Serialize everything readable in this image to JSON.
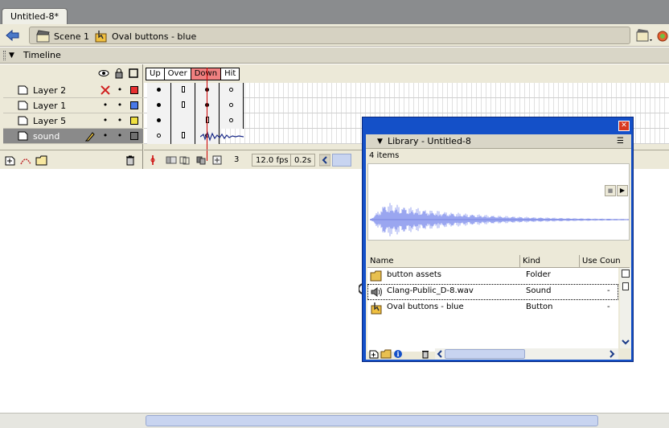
{
  "document": {
    "tab_title": "Untitled-8*"
  },
  "editbar": {
    "scene": "Scene 1",
    "symbol": "Oval buttons - blue"
  },
  "timeline": {
    "title": "Timeline",
    "frame_labels": [
      "Up",
      "Over",
      "Down",
      "Hit"
    ],
    "current_frame_label": "Down",
    "layers": [
      {
        "name": "Layer 2",
        "visibility": "x",
        "lock": "•",
        "color": "#e83030",
        "frames": [
          "dot",
          "rect",
          "dot",
          "ring"
        ]
      },
      {
        "name": "Layer 1",
        "visibility": "•",
        "lock": "•",
        "color": "#4878e8",
        "frames": [
          "dot",
          "rect",
          "dot",
          "ring"
        ]
      },
      {
        "name": "Layer 5",
        "visibility": "•",
        "lock": "•",
        "color": "#f0e040",
        "frames": [
          "dot",
          "",
          "rect",
          "ring"
        ]
      },
      {
        "name": "sound",
        "visibility": "•",
        "lock": "•",
        "color": "#707070",
        "frames": [
          "ring",
          "rect",
          "ring",
          "wave"
        ]
      }
    ],
    "status": {
      "frame": "3",
      "fps": "12.0 fps",
      "time": "0.2s"
    }
  },
  "library": {
    "title": "Library - Untitled-8",
    "count_text": "4 items",
    "columns": {
      "name": "Name",
      "kind": "Kind",
      "use_count": "Use Coun"
    },
    "items": [
      {
        "name": "button assets",
        "kind": "Folder",
        "use": "",
        "icon": "folder-icon"
      },
      {
        "name": "Clang-Public_D-8.wav",
        "kind": "Sound",
        "use": "-",
        "icon": "speaker-icon"
      },
      {
        "name": "Oval buttons - blue",
        "kind": "Button",
        "use": "-",
        "icon": "button-symbol-icon"
      }
    ]
  },
  "colors": {
    "accent": "#1450c8",
    "playhead": "#cc0000",
    "panel": "#ece9d8"
  }
}
